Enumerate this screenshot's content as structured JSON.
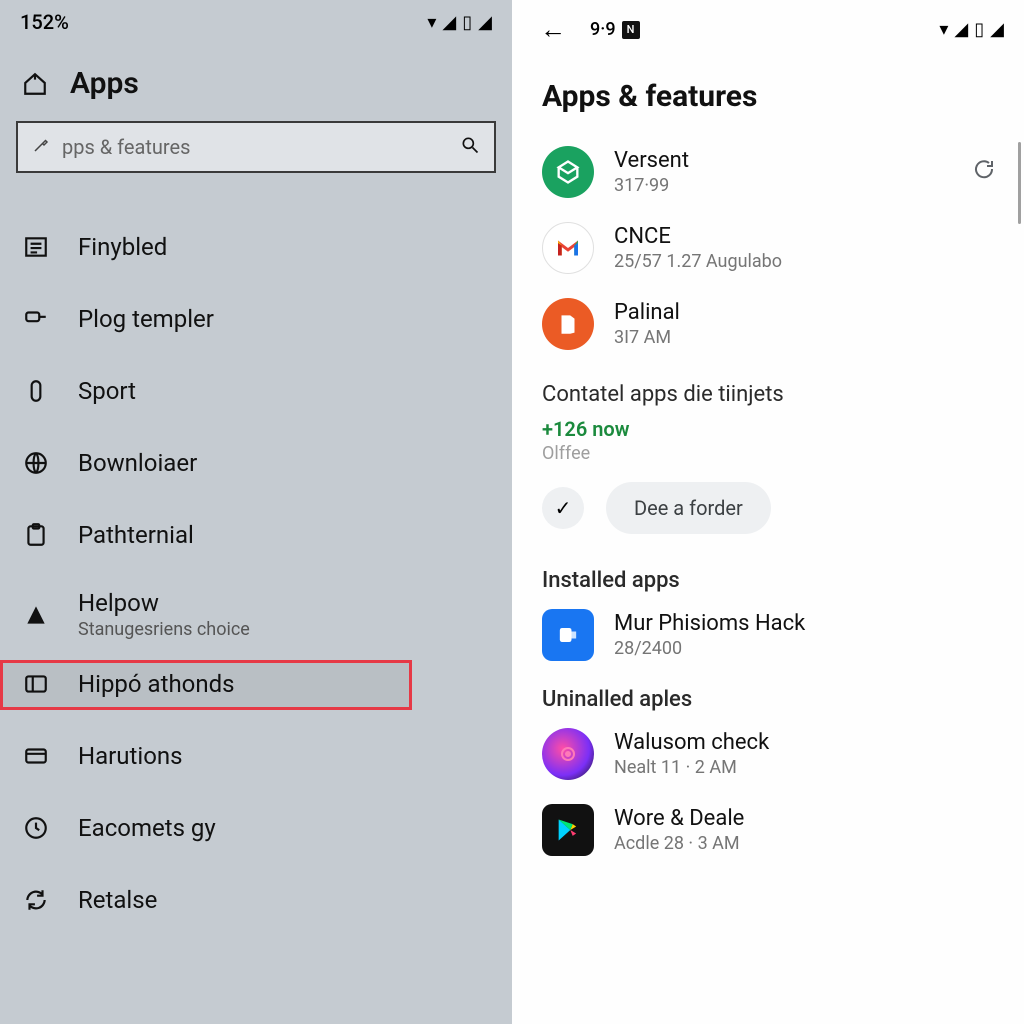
{
  "left": {
    "status_pct": "152%",
    "title": "Apps",
    "search_placeholder": "pps & features",
    "nav": [
      {
        "label": "Finybled"
      },
      {
        "label": "Plog templer"
      },
      {
        "label": "Sport"
      },
      {
        "label": "Bownloiaer"
      },
      {
        "label": "Pathternial"
      },
      {
        "label": "Helpow",
        "sub": "Stanugesriens choice"
      },
      {
        "label": "Hippó athonds"
      },
      {
        "label": "Harutions"
      },
      {
        "label": "Eacomets gy"
      },
      {
        "label": "Retalse"
      }
    ]
  },
  "right": {
    "time": "9·9",
    "title": "Apps & features",
    "apps_top": [
      {
        "name": "Versent",
        "sub": "317·99",
        "icon": "versent",
        "trailing": "sync"
      },
      {
        "name": "CNCE",
        "sub": "25/57 1.27 Augulabo",
        "icon": "gmail"
      },
      {
        "name": "Palinal",
        "sub": "3I7 AM",
        "icon": "office",
        "trailing": "dot"
      }
    ],
    "contatel_title": "Contatel apps die tiinjets",
    "contatel_count": "+126 now",
    "contatel_muted": "Olffee",
    "folder_button": "Dee a forder",
    "installed_heading": "Installed apps",
    "installed": [
      {
        "name": "Mur Phisioms Hack",
        "sub": "28/2400",
        "icon": "phisioms"
      }
    ],
    "uninstalled_heading": "Uninalled aples",
    "uninstalled": [
      {
        "name": "Walusom check",
        "sub": "Nealt 11 · 2 AM",
        "icon": "walusom"
      },
      {
        "name": "Wore & Deale",
        "sub": "Acdle 28 · 3 AM",
        "icon": "play"
      }
    ]
  }
}
